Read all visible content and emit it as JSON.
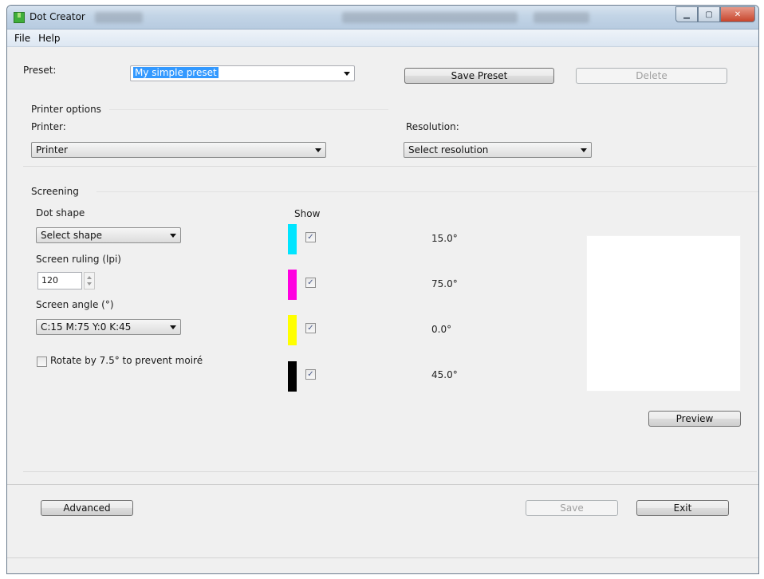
{
  "window": {
    "title": "Dot Creator"
  },
  "menu": {
    "items": [
      "File",
      "Help"
    ]
  },
  "preset": {
    "label": "Preset:",
    "value": "My simple preset",
    "save_label": "Save Preset",
    "delete_label": "Delete"
  },
  "printer_options": {
    "group_label": "Printer options",
    "printer_label": "Printer:",
    "printer_value": "Printer",
    "resolution_label": "Resolution:",
    "resolution_value": "Select resolution"
  },
  "screening": {
    "group_label": "Screening",
    "dot_shape_label": "Dot shape",
    "dot_shape_value": "Select shape",
    "ruling_label": "Screen ruling (lpi)",
    "ruling_value": "120",
    "angle_label": "Screen angle (°)",
    "angle_value": "C:15 M:75 Y:0 K:45",
    "rotate_label": "Rotate by 7.5° to prevent moiré",
    "rotate_checked": false,
    "show_label": "Show",
    "channels": [
      {
        "name": "cyan",
        "color": "#00e5ff",
        "checked": true,
        "angle": "15.0°"
      },
      {
        "name": "magenta",
        "color": "#ff00e0",
        "checked": true,
        "angle": "75.0°"
      },
      {
        "name": "yellow",
        "color": "#ffff00",
        "checked": true,
        "angle": "0.0°"
      },
      {
        "name": "black",
        "color": "#000000",
        "checked": true,
        "angle": "45.0°"
      }
    ],
    "preview_label": "Preview"
  },
  "footer": {
    "advanced_label": "Advanced",
    "save_label": "Save",
    "exit_label": "Exit"
  },
  "icons": {
    "app": "dot-creator-app-icon",
    "minimize": "minimize-icon",
    "maximize": "maximize-icon",
    "close": "close-icon",
    "dropdown": "chevron-down-icon",
    "check": "checkmark-icon"
  }
}
